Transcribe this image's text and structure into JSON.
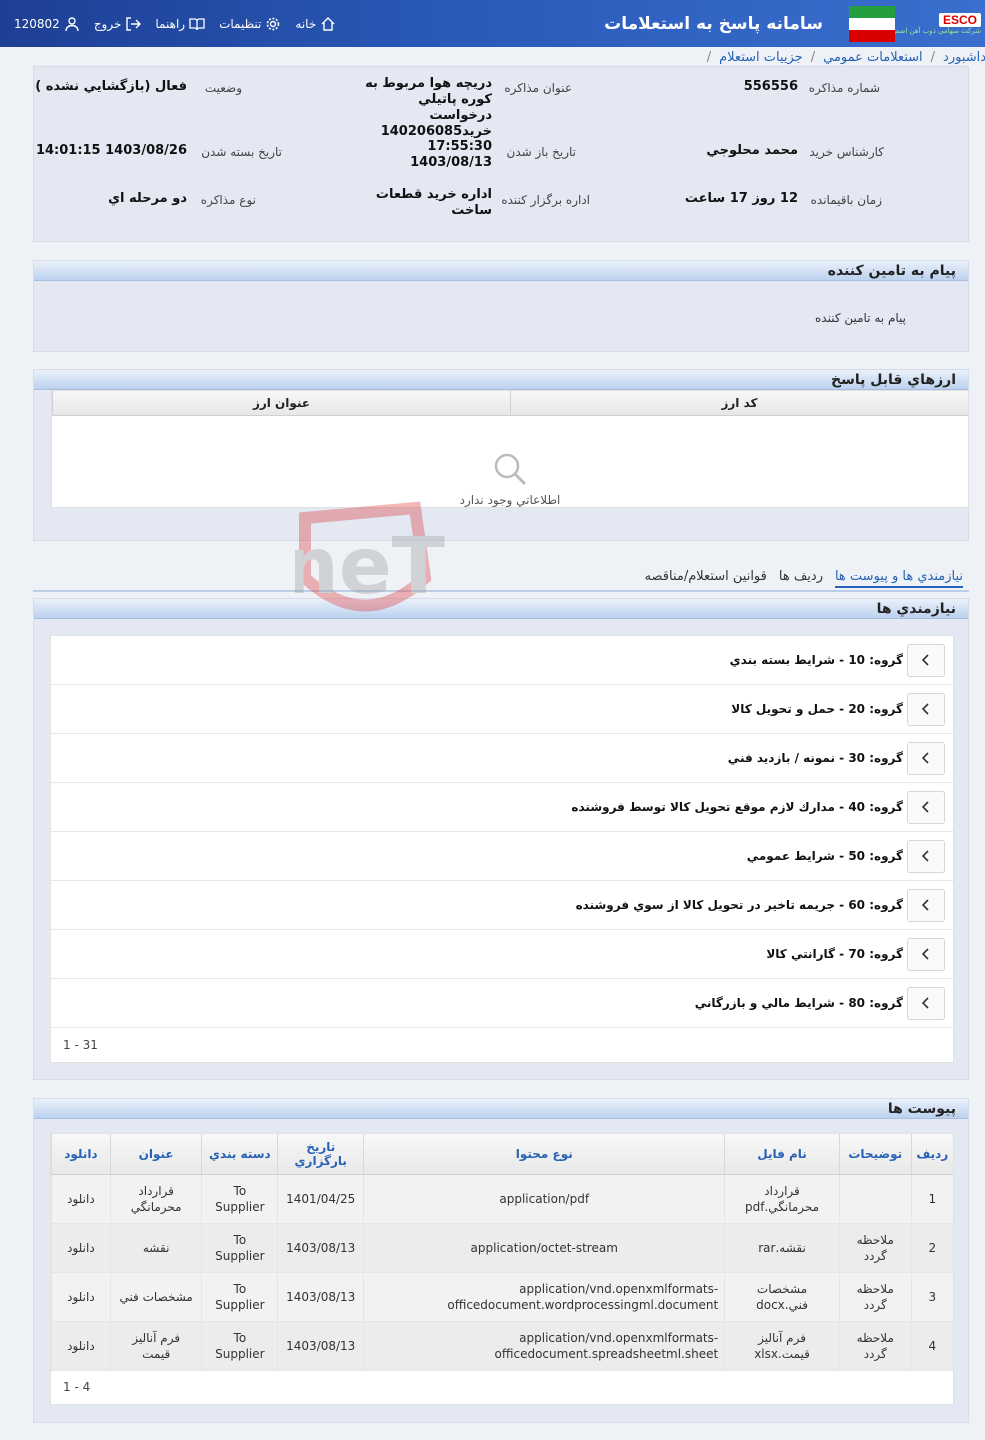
{
  "header": {
    "app_title": "سامانه پاسخ به استعلامات",
    "brand_logo": "ESCO",
    "brand_sub": "شرکت سهامی ذوب آهن اصفهان",
    "nav": {
      "home": "خانه",
      "settings": "تنظیمات",
      "help": "راهنما",
      "logout": "خروج",
      "user_id": "120802"
    }
  },
  "breadcrumb": [
    "ه داشبورد",
    "استعلامات عمومي",
    "جزييات استعلام"
  ],
  "info": {
    "number_label": "شماره مذاكره",
    "number_value": "556556",
    "title_label": "عنوان مذاكره",
    "title_value": "دريچه هوا مربوط به كوره پاتيلي درخواست خريد140206085",
    "status_label": "وضعيت",
    "status_value": "فعال (بازگشايي نشده )",
    "expert_label": "كارشناس خريد",
    "expert_value": "محمد محلوجي",
    "open_label": "تاريخ باز شدن",
    "open_value": "17:55:30 1403/08/13",
    "close_label": "تاريخ بسته شدن",
    "close_value": "1403/08/26 14:01:15",
    "remain_label": "زمان باقيمانده",
    "remain_value": "12 روز 17 ساعت",
    "org_label": "اداره برگزار كننده",
    "org_value": "اداره خريد قطعات ساخت",
    "type_label": "نوع مذاكره",
    "type_value": "دو مرحله اي"
  },
  "message": {
    "title": "پيام به تامين كننده",
    "body": "پيام به تامين كننده"
  },
  "currencies": {
    "title": "ارزهاي قابل پاسخ",
    "columns": [
      "كد ارز",
      "عنوان ارز"
    ],
    "empty_text": "اطلاعاتي وجود ندارد"
  },
  "tabs": [
    "نيازمندي ها و پيوست ها",
    "رديف ها",
    "قوانين استعلام/مناقصه"
  ],
  "needs": {
    "title": "نيازمندي ها",
    "items": [
      "گروه: 10 - شرايط بسته بندي",
      "گروه: 20 - حمل و تحويل كالا",
      "گروه: 30 - نمونه / بازديد فني",
      "گروه: 40 - مدارك لازم موقع تحويل كالا توسط فروشنده",
      "گروه: 50 - شرايط عمومي",
      "گروه: 60 - جريمه تاخير در تحويل كالا از سوي فروشنده",
      "گروه: 70 - گارانتي كالا",
      "گروه: 80 - شرايط مالي و بازرگاني"
    ],
    "pager": "1 - 31"
  },
  "attachments": {
    "title": "پيوست ها",
    "columns": [
      "رديف",
      "توضيحات",
      "نام فايل",
      "نوع محتوا",
      "تاريخ بارگزاري",
      "دسته بندي",
      "عنوان",
      "دانلود"
    ],
    "rows": [
      [
        "1",
        "",
        "قرارداد محرمانگي.pdf",
        "application/pdf",
        "1401/04/25",
        "To Supplier",
        "قرارداد محرمانگي",
        "دانلود"
      ],
      [
        "2",
        "ملاحظه گردد",
        "نقشه.rar",
        "application/octet-stream",
        "1403/08/13",
        "To Supplier",
        "نقشه",
        "دانلود"
      ],
      [
        "3",
        "ملاحظه گردد",
        "مشخصات فني.docx",
        "application/vnd.openxmlformats-officedocument.wordprocessingml.document",
        "1403/08/13",
        "To Supplier",
        "مشخصات فني",
        "دانلود"
      ],
      [
        "4",
        "ملاحظه گردد",
        "فرم آناليز قيمت.xlsx",
        "application/vnd.openxmlformats-officedocument.spreadsheetml.sheet",
        "1403/08/13",
        "To Supplier",
        "فرم آناليز قيمت",
        "دانلود"
      ]
    ],
    "pager": "1 - 4"
  },
  "watermark": "AriaTender.neT",
  "colors": {
    "header": "#2a59b8",
    "link": "#2762b6",
    "panel": "#e3e8f3"
  }
}
